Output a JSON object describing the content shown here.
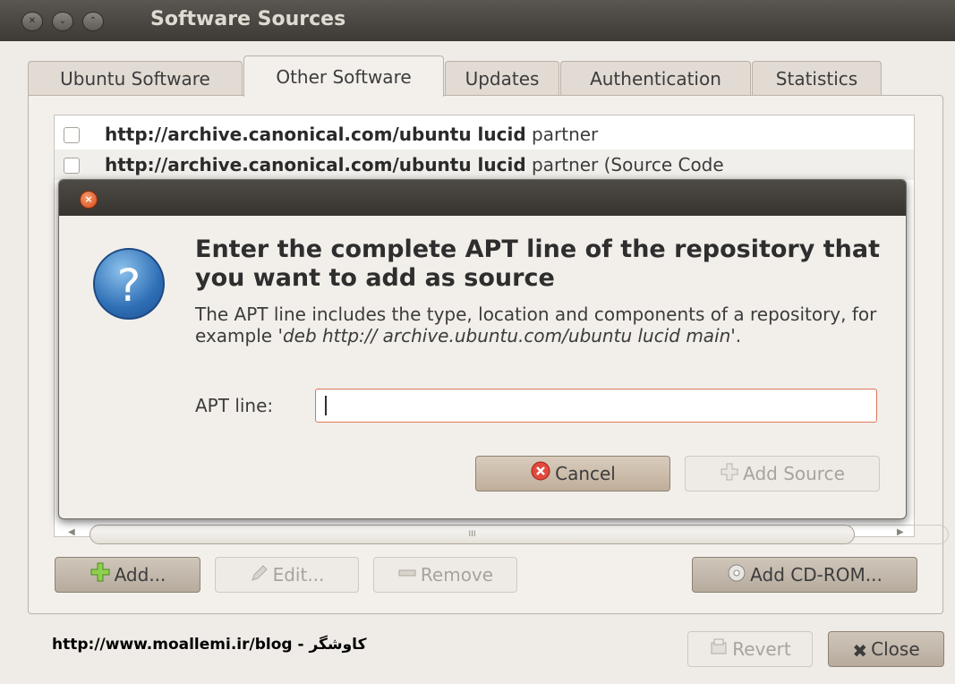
{
  "window": {
    "title": "Software Sources"
  },
  "tabs": [
    {
      "label": "Ubuntu Software"
    },
    {
      "label": "Other Software"
    },
    {
      "label": "Updates"
    },
    {
      "label": "Authentication"
    },
    {
      "label": "Statistics"
    }
  ],
  "sources": [
    {
      "url": "http://archive.canonical.com/ubuntu lucid",
      "component": "partner",
      "checked": false
    },
    {
      "url": "http://archive.canonical.com/ubuntu lucid",
      "component": "partner (Source Code",
      "checked": false
    }
  ],
  "dialog": {
    "heading": "Enter the complete APT line of the repository that you want to add as source",
    "body_prefix": "The APT line includes the type, location and components of a repository, for example  '",
    "body_example": "deb http:// archive.ubuntu.com/ubuntu lucid main",
    "body_suffix": "'.",
    "apt_label": "APT line:",
    "apt_value": "",
    "cancel_label": "Cancel",
    "add_source_label": "Add Source"
  },
  "scrollbar": {
    "thumb_grip": "III"
  },
  "actions": {
    "add_label": "Add...",
    "edit_label": "Edit...",
    "remove_label": "Remove",
    "add_cdrom_label": "Add CD-ROM..."
  },
  "footer": {
    "watermark": "http://www.moallemi.ir/blog - کاوشگر",
    "revert_label": "Revert",
    "close_label": "Close"
  }
}
